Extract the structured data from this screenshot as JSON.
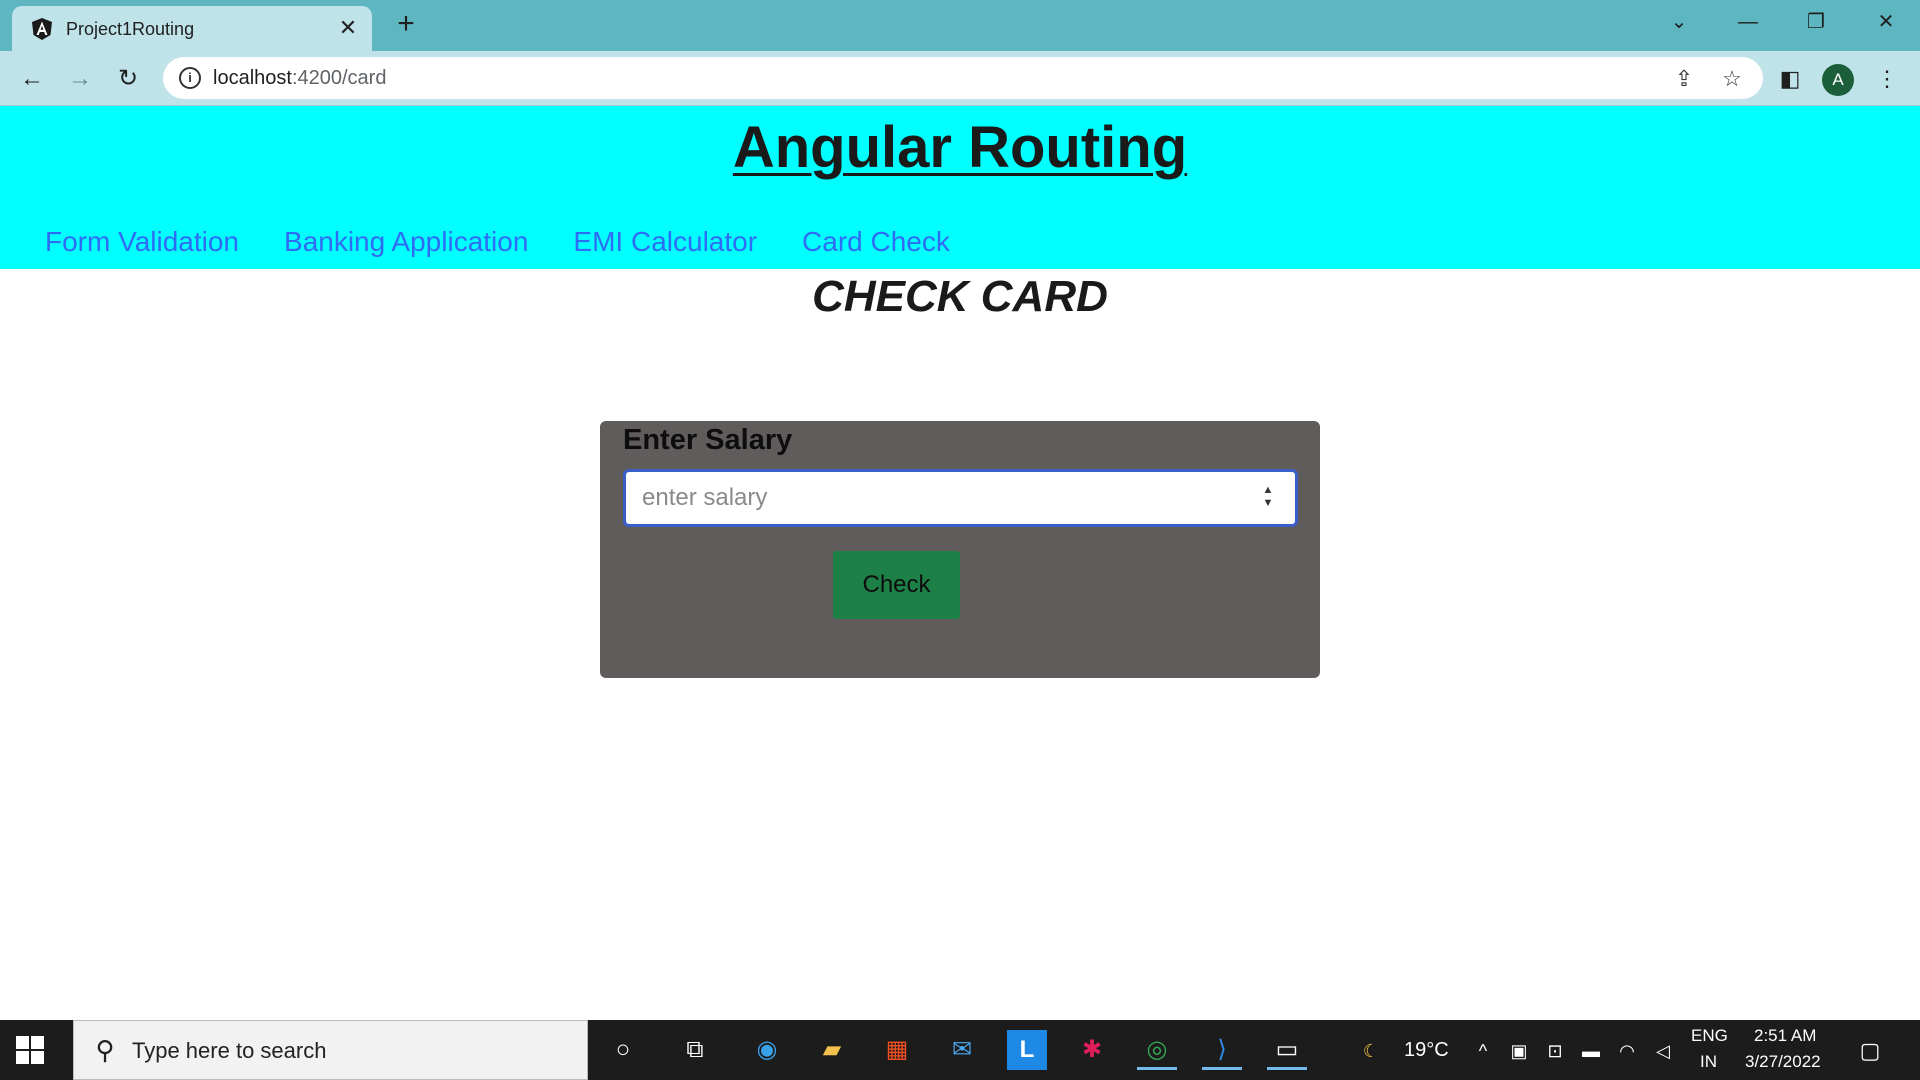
{
  "browser": {
    "tab": {
      "title": "Project1Routing",
      "close_label": "✕",
      "favicon": "angular-icon"
    },
    "new_tab_label": "+",
    "window_controls": {
      "tab_search": "⌄",
      "minimize": "—",
      "restore": "❐",
      "close": "✕"
    },
    "address": {
      "host": "localhost",
      "path": ":4200/card"
    }
  },
  "page": {
    "app_title": "Angular Routing",
    "nav": [
      {
        "label": "Form Validation"
      },
      {
        "label": "Banking Application"
      },
      {
        "label": "EMI Calculator"
      },
      {
        "label": "Card Check"
      }
    ],
    "section_title": "CHECK CARD",
    "form": {
      "salary_label": "Enter Salary",
      "salary_placeholder": "enter salary",
      "salary_value": "",
      "check_button": "Check"
    },
    "colors": {
      "hero_bg": "#00ffff",
      "nav_link": "#2f6cf5",
      "card_bg": "#605c5c",
      "button_bg": "#1c8047"
    }
  },
  "taskbar": {
    "search_placeholder": "Type here to search",
    "weather": "19°C",
    "language": "ENG",
    "region": "IN",
    "time": "2:51 AM",
    "date": "3/27/2022"
  }
}
